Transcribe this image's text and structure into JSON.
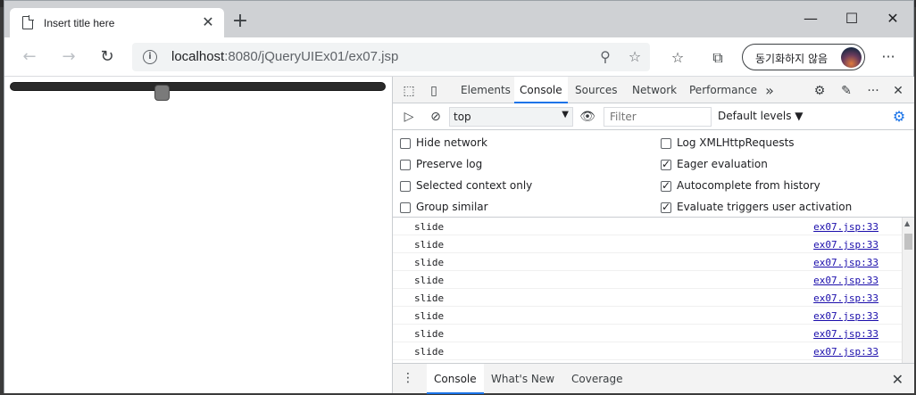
{
  "browser": {
    "tab_title": "Insert title here",
    "tab_close": "✕",
    "new_tab": "+",
    "window_controls": {
      "minimize": "—",
      "maximize": "☐",
      "close": "✕"
    },
    "back_icon": "back-arrow-icon",
    "forward_icon": "forward-arrow-icon",
    "refresh_icon": "refresh-icon",
    "url_host": "localhost",
    "url_rest": ":8080/jQueryUIEx01/ex07.jsp",
    "sync_label": "동기화하지 않음",
    "more_label": "···"
  },
  "page": {
    "slider_value_fraction": 0.4
  },
  "devtools": {
    "tabs": [
      "Elements",
      "Console",
      "Sources",
      "Network",
      "Performance"
    ],
    "active_tab": "Console",
    "more_tabs": "»",
    "context": "top",
    "filter_placeholder": "Filter",
    "levels": "Default levels ▼",
    "options_left": [
      {
        "label": "Hide network",
        "checked": false
      },
      {
        "label": "Preserve log",
        "checked": false
      },
      {
        "label": "Selected context only",
        "checked": false
      },
      {
        "label": "Group similar",
        "checked": false
      }
    ],
    "options_right": [
      {
        "label": "Log XMLHttpRequests",
        "checked": false
      },
      {
        "label": "Eager evaluation",
        "checked": true
      },
      {
        "label": "Autocomplete from history",
        "checked": true
      },
      {
        "label": "Evaluate triggers user activation",
        "checked": true
      }
    ],
    "log": [
      {
        "msg": "slide",
        "src": "ex07.jsp:33"
      },
      {
        "msg": "slide",
        "src": "ex07.jsp:33"
      },
      {
        "msg": "slide",
        "src": "ex07.jsp:33"
      },
      {
        "msg": "slide",
        "src": "ex07.jsp:33"
      },
      {
        "msg": "slide",
        "src": "ex07.jsp:33"
      },
      {
        "msg": "slide",
        "src": "ex07.jsp:33"
      },
      {
        "msg": "slide",
        "src": "ex07.jsp:33"
      },
      {
        "msg": "slide",
        "src": "ex07.jsp:33"
      }
    ],
    "drawer": {
      "dots": "⋮",
      "tabs": [
        "Console",
        "What's New",
        "Coverage"
      ],
      "active": "Console",
      "close": "✕"
    }
  },
  "colors": {
    "accent": "#1a73e8",
    "link": "#1a0dab"
  }
}
